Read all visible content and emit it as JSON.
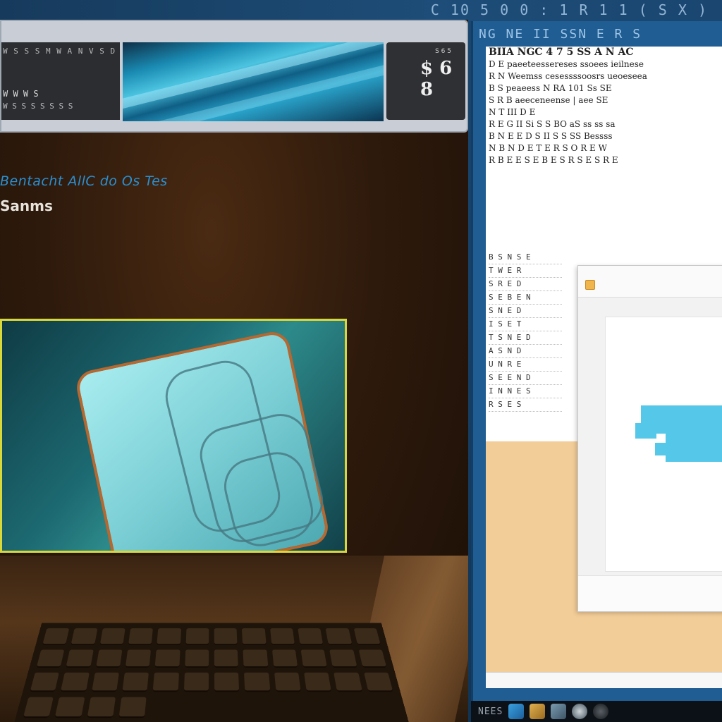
{
  "top_strip": {
    "text": "C 10 5 0 0 : 1 R 1 1 ( S X )"
  },
  "left_window": {
    "banner": {
      "line_1": "W S S S M W A N V S D",
      "line_2": "W W W S",
      "line_3": "W S S S S S S S",
      "box_small": "S 6 5",
      "box_number": "$ 6 8"
    },
    "heading_link": "Bentacht AllC do Os Tes",
    "heading_sub": "Sanms"
  },
  "right_window": {
    "title": "NG NE II SSN E R S",
    "doc_lines": [
      "BIIA NGC 4 7 5 SS A N AC",
      "D E paeeteessereses ssoees ieilnese",
      "R N Weemss cesessssoosrs ueoeseea",
      "B S peaeess N RA 101 Ss SE",
      "S R B aeeceneense | aee SE",
      "N T III D E",
      "R E G II Si S S BO aS ss ss sa",
      "B N E E D S II S S SS Bessss",
      "N B N D E T E R S O R E W",
      "R B E E S E B E S R S E S R E"
    ],
    "doc_left_col": [
      "B S N S E",
      "T W E R",
      "S R E D",
      "S E B E N",
      "S N E D",
      "I S E T",
      "T S N E D",
      "A S N D",
      "U N R E",
      "S E E N D",
      "I N N E S",
      "R S E S"
    ]
  },
  "taskbar": {
    "label": "NEES",
    "icon_names": [
      "app-icon-blue",
      "folder-icon",
      "media-icon",
      "settings-icon",
      "power-icon"
    ]
  },
  "colors": {
    "desktop_blue": "#1b466f",
    "left_bg_brown": "#2e1a0c",
    "video_border_yellow": "#d9d83a",
    "link_blue": "#2b8fd0",
    "shape_cyan": "#55c7e8",
    "doc_peach": "#f3cd98"
  }
}
